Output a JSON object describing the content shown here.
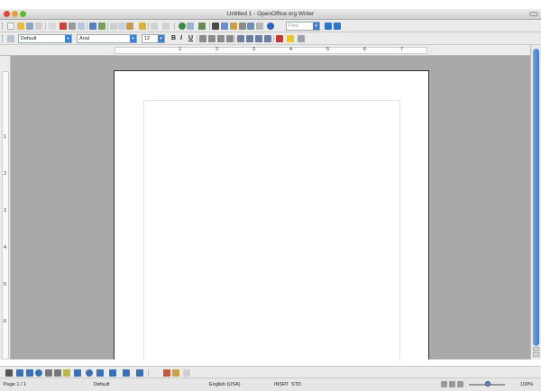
{
  "window": {
    "title": "Untitled 1 - OpenOffice.org Writer"
  },
  "standard_toolbar": {
    "find_placeholder": "Find",
    "icons": [
      "new-document-icon",
      "open-folder-icon",
      "save-icon",
      "email-icon",
      "edit-file-icon",
      "export-pdf-icon",
      "print-icon",
      "page-preview-icon",
      "spellcheck-icon",
      "autospellcheck-icon",
      "cut-icon",
      "copy-icon",
      "paste-icon",
      "format-paintbrush-icon",
      "undo-icon",
      "redo-icon",
      "hyperlink-icon",
      "table-icon",
      "show-draw-functions-icon",
      "find-replace-icon",
      "navigator-icon",
      "gallery-icon",
      "data-sources-icon",
      "nonprinting-characters-icon",
      "zoom-icon",
      "help-icon"
    ]
  },
  "formatting_toolbar": {
    "style": "Default",
    "font": "Arial",
    "size": "12",
    "bold": "B",
    "italic": "I",
    "underline": "U"
  },
  "ruler": {
    "marks": [
      "1",
      "2",
      "3",
      "4",
      "5",
      "6",
      "7"
    ]
  },
  "vruler": {
    "marks": [
      "1",
      "2",
      "3",
      "4",
      "5",
      "6"
    ]
  },
  "statusbar": {
    "page": "Page 1 / 1",
    "style": "Default",
    "language": "English (USA)",
    "insert_mode": "INSRT",
    "selection_mode": "STD",
    "zoom": "100%"
  }
}
